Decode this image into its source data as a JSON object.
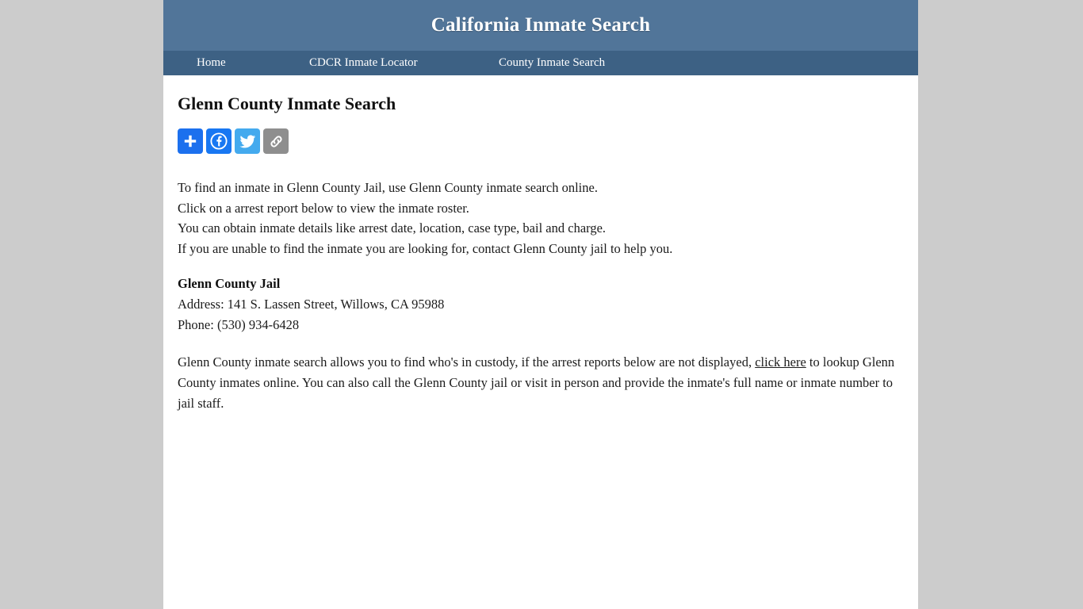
{
  "header": {
    "title": "California Inmate Search",
    "bg_color": "#517599"
  },
  "nav": {
    "bg_color": "#3d6184",
    "items": [
      {
        "label": "Home"
      },
      {
        "label": "CDCR Inmate Locator"
      },
      {
        "label": "County Inmate Search"
      }
    ]
  },
  "main": {
    "page_title": "Glenn County Inmate Search",
    "share": {
      "buttons": [
        {
          "name": "addthis",
          "label": "Share",
          "color": "#1c70ee"
        },
        {
          "name": "facebook",
          "label": "Facebook",
          "color": "#1877f2"
        },
        {
          "name": "twitter",
          "label": "Twitter",
          "color": "#44aaee"
        },
        {
          "name": "copy-link",
          "label": "Copy Link",
          "color": "#8e8e8e"
        }
      ]
    },
    "intro_lines": [
      "To find an inmate in Glenn County Jail, use Glenn County inmate search online.",
      "Click on a arrest report below to view the inmate roster.",
      "You can obtain inmate details like arrest date, location, case type, bail and charge.",
      "If you are unable to find the inmate you are looking for, contact Glenn County jail to help you."
    ],
    "jail": {
      "name": "Glenn County Jail",
      "address": "Address: 141 S. Lassen Street, Willows, CA 95988",
      "phone": "Phone: (530) 934-6428"
    },
    "outro": {
      "before_link": "Glenn County inmate search allows you to find who's in custody, if the arrest reports below are not displayed, ",
      "link_text": "click here",
      "after_link": " to lookup Glenn County inmates online. You can also call the Glenn County jail or visit in person and provide the inmate's full name or inmate number to jail staff."
    }
  }
}
